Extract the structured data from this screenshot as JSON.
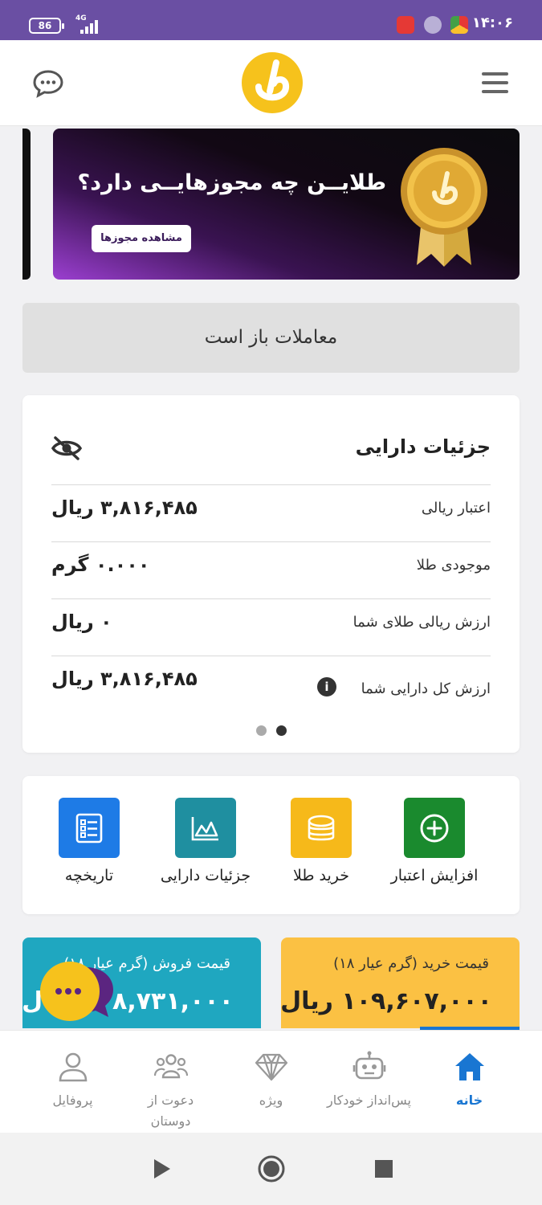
{
  "status_bar": {
    "time": "۱۴:۰۶",
    "battery": "86",
    "network": "4G"
  },
  "header": {
    "menu_icon": "hamburger-menu-icon",
    "logo_icon": "talayin-logo-icon",
    "chat_icon": "chat-bubble-icon"
  },
  "banner": {
    "title": "طلایــن چه مجوزهایــی دارد؟",
    "button_label": "مشاهده مجوزها"
  },
  "trade_status": {
    "text": "معاملات باز است"
  },
  "assets": {
    "title": "جزئیات دارایی",
    "rows": [
      {
        "label": "اعتبار ریالی",
        "value": "۳,۸۱۶,۴۸۵ ریال"
      },
      {
        "label": "موجودی طلا",
        "value": "۰.۰۰۰ گرم"
      },
      {
        "label": "ارزش ریالی طلای شما",
        "value": "۰ ریال"
      },
      {
        "label": "ارزش کل دارایی شما",
        "value": "۳,۸۱۶,۴۸۵ ریال"
      }
    ],
    "page_count": 2,
    "active_page": 2
  },
  "actions": [
    {
      "label": "افزایش اعتبار",
      "icon": "plus-circle-icon",
      "color": "#1a8a2e"
    },
    {
      "label": "خرید طلا",
      "icon": "coins-icon",
      "color": "#f6b91a"
    },
    {
      "label": "جزئیات دارایی",
      "icon": "chart-icon",
      "color": "#1f8fa0"
    },
    {
      "label": "تاریخچه",
      "icon": "checklist-icon",
      "color": "#1e7be6"
    }
  ],
  "prices": {
    "buy": {
      "title": "قیمت خرید (گرم عیار ۱۸)",
      "value": "۱۰۹,۶۰۷,۰۰۰ ریال",
      "color": "#fbc143"
    },
    "sell": {
      "title": "قیمت فروش (گرم عیار ۱۸)",
      "value": "۱۰۸,۷۳۱,۰۰۰ ریال",
      "color": "#1fa7c0"
    }
  },
  "bottom_nav": [
    {
      "label": "خانه",
      "icon": "home-icon",
      "active": true
    },
    {
      "label": "پس‌انداز خودکار",
      "icon": "robot-icon",
      "active": false
    },
    {
      "label": "ویژه",
      "icon": "diamond-icon",
      "active": false
    },
    {
      "label": "دعوت از دوستان",
      "icon": "group-icon",
      "active": false
    },
    {
      "label": "پروفایل",
      "icon": "user-icon",
      "active": false
    }
  ],
  "colors": {
    "status_bar": "#6a4fa3",
    "accent_blue": "#1976d2",
    "gold": "#f6c21c"
  }
}
